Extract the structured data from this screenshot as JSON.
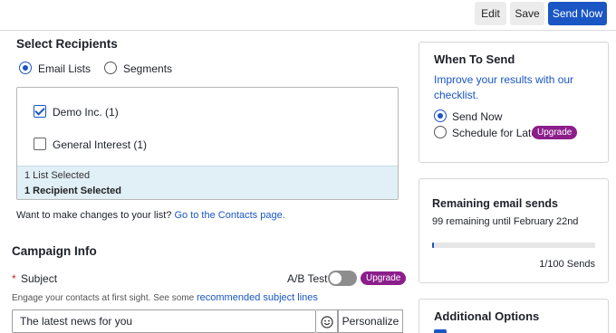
{
  "toolbar": {
    "edit_label": "Edit",
    "save_label": "Save",
    "send_now_label": "Send Now"
  },
  "recipients": {
    "title": "Select Recipients",
    "mode_options": [
      {
        "label": "Email Lists",
        "selected": true
      },
      {
        "label": "Segments",
        "selected": false
      }
    ],
    "lists": [
      {
        "label": "Demo Inc. (1)",
        "checked": true
      },
      {
        "label": "General Interest (1)",
        "checked": false
      }
    ],
    "summary_lists": "1 List Selected",
    "summary_recipients": "1 Recipient Selected",
    "change_text": "Want to make changes to your list?",
    "change_link": "Go to the Contacts page."
  },
  "campaign": {
    "title": "Campaign Info",
    "subject_required_mark": "*",
    "subject_label": "Subject",
    "ab_test_label": "A/B Test",
    "ab_test_enabled": false,
    "upgrade_label": "Upgrade",
    "hint_text": "Engage your contacts at first sight. See some",
    "hint_link": "recommended subject lines",
    "subject_value": "The latest news for you",
    "personalize_label": "Personalize"
  },
  "when_to_send": {
    "title": "When To Send",
    "improve_link": "Improve your results with our checklist.",
    "options": [
      {
        "label": "Send Now",
        "selected": true
      },
      {
        "label": "Schedule for Later",
        "selected": false
      }
    ],
    "upgrade_label": "Upgrade"
  },
  "remaining": {
    "title": "Remaining email sends",
    "subtitle": "99 remaining until February 22nd",
    "progress_fraction": 0.01,
    "sends_text": "1/100 Sends"
  },
  "additional": {
    "title": "Additional Options"
  },
  "colors": {
    "accent": "#1a56c4",
    "upgrade_pill": "#8c1e8c",
    "list_footer_bg": "#e1eff6"
  },
  "icons": {
    "emoji": "smiley-icon"
  }
}
